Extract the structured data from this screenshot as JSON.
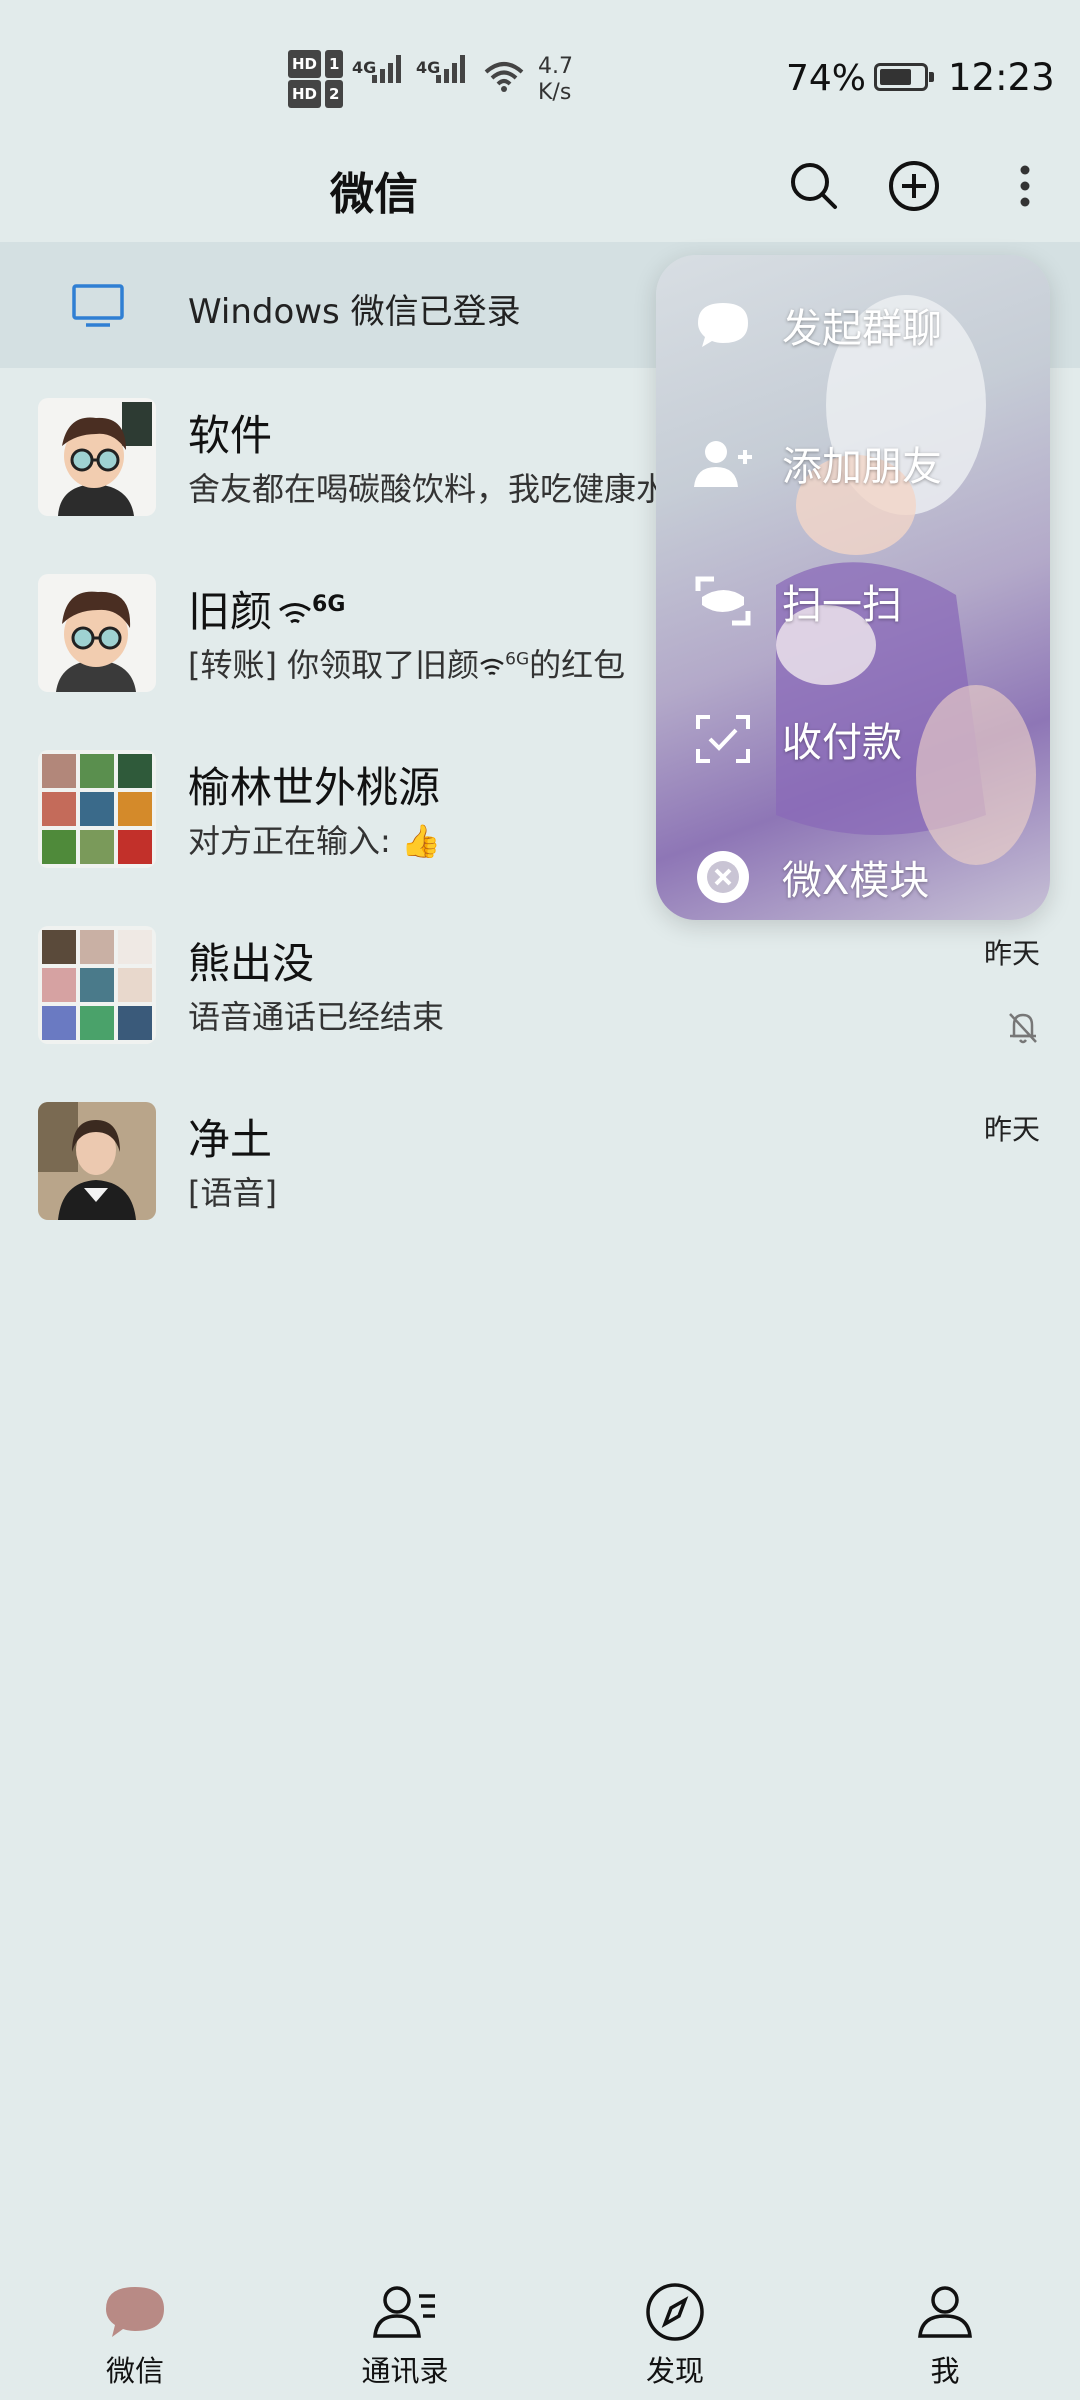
{
  "status_bar": {
    "hd1": "HD",
    "hd1_num": "1",
    "hd2": "HD",
    "hd2_num": "2",
    "net1": "4G",
    "net2": "4G",
    "speed_value": "4.7",
    "speed_unit": "K/s",
    "battery_pct": "74%",
    "battery_level": 0.74,
    "time": "12:23"
  },
  "header": {
    "title": "微信",
    "icons": [
      "search-icon",
      "plus-circle-icon",
      "more-vertical-icon"
    ]
  },
  "banner": {
    "icon": "monitor-icon",
    "text": "Windows 微信已登录"
  },
  "chats": [
    {
      "name": "软件",
      "message": "舍友都在喝碳酸饮料，我吃健康水",
      "time": "",
      "muted": false
    },
    {
      "name": "旧颜",
      "name_suffix": "6G",
      "message": "[转账] 你领取了旧颜",
      "message_suffix": "6G",
      "message_tail": "的红包",
      "time": "",
      "muted": false
    },
    {
      "name": "榆林世外桃源",
      "message": "对方正在输入:",
      "message_emoji": "👍",
      "time": "",
      "muted": false
    },
    {
      "name": "熊出没",
      "message": "语音通话已经结束",
      "time": "昨天",
      "muted": true
    },
    {
      "name": "净土",
      "message": "[语音]",
      "time": "昨天",
      "muted": false
    }
  ],
  "popup_menu": {
    "items": [
      {
        "label": "发起群聊",
        "icon": "chat-bubble-icon"
      },
      {
        "label": "添加朋友",
        "icon": "add-friend-icon"
      },
      {
        "label": "扫一扫",
        "icon": "scan-icon"
      },
      {
        "label": "收付款",
        "icon": "payment-icon"
      },
      {
        "label": "微X模块",
        "icon": "module-close-icon"
      }
    ]
  },
  "bottom_nav": {
    "items": [
      {
        "label": "微信",
        "icon": "chat-icon",
        "active": true
      },
      {
        "label": "通讯录",
        "icon": "contacts-icon",
        "active": false
      },
      {
        "label": "发现",
        "icon": "compass-icon",
        "active": false
      },
      {
        "label": "我",
        "icon": "profile-icon",
        "active": false
      }
    ]
  },
  "colors": {
    "background": "#e2ebeb",
    "banner": "#d4e0e2",
    "active_tab_icon": "#b88a85",
    "banner_icon": "#2f7fd3"
  }
}
